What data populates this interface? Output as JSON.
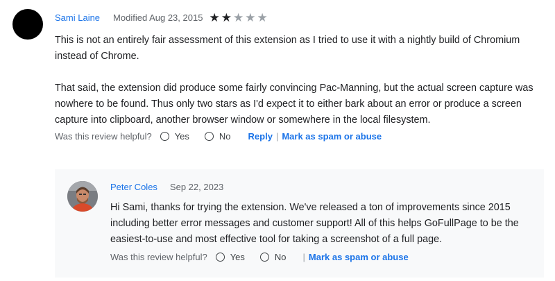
{
  "review": {
    "author": "Sami Laine",
    "modified": "Modified Aug 23, 2015",
    "rating": 2,
    "max_rating": 5,
    "paragraphs": [
      "This is not an entirely fair assessment of this extension as I tried to use it with a nightly build of Chromium instead of Chrome.",
      "That said, the extension did produce some fairly convincing Pac-Manning, but the actual screen capture was nowhere to be found. Thus only two stars as I'd expect it to either bark about an error or produce a screen capture into clipboard, another browser window or somewhere in the local filesystem."
    ],
    "helpful_label": "Was this review helpful?",
    "yes_label": "Yes",
    "no_label": "No",
    "reply_link": "Reply",
    "spam_link": "Mark as spam or abuse"
  },
  "developer_reply": {
    "author": "Peter Coles",
    "date": "Sep 22, 2023",
    "text": "Hi Sami, thanks for trying the extension. We've released a ton of improvements since 2015 including better error messages and customer support! All of this helps GoFullPage to be the easiest-to-use and most effective tool for taking a screenshot of a full page.",
    "helpful_label": "Was this review helpful?",
    "yes_label": "Yes",
    "no_label": "No",
    "spam_link": "Mark as spam or abuse"
  },
  "colors": {
    "link": "#1a73e8",
    "reply_background": "#f8f9fa"
  },
  "icons": {
    "filled_star": "star-filled-icon",
    "empty_star": "star-empty-icon",
    "radio": "radio-unchecked-icon"
  }
}
